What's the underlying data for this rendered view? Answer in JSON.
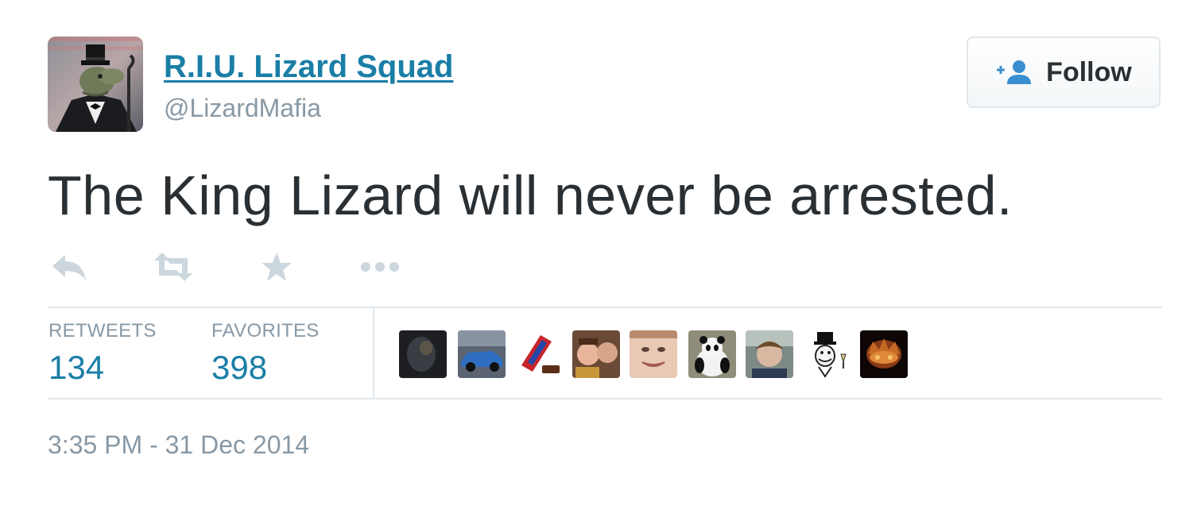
{
  "author": {
    "display_name": "R.I.U. Lizard Squad",
    "screen_name": "@LizardMafia",
    "avatar_icon": "lizard-in-top-hat-avatar"
  },
  "follow_button": {
    "label": "Follow",
    "icon": "add-user-icon"
  },
  "tweet": {
    "text": "The King Lizard will never be arrested."
  },
  "actions": [
    {
      "name": "reply",
      "icon": "reply-icon"
    },
    {
      "name": "retweet",
      "icon": "retweet-icon"
    },
    {
      "name": "favorite",
      "icon": "star-icon"
    },
    {
      "name": "more",
      "icon": "more-dots-icon"
    }
  ],
  "stats": {
    "retweets": {
      "label": "RETWEETS",
      "value": "134"
    },
    "favorites": {
      "label": "FAVORITES",
      "value": "398"
    }
  },
  "favoriter_avatars": [
    "dark-scene-avatar",
    "blue-car-avatar",
    "candy-bar-avatar",
    "two-kids-avatar",
    "smiling-face-avatar",
    "panda-avatar",
    "young-man-avatar",
    "top-hat-meme-avatar",
    "crown-avatar"
  ],
  "timestamp": "3:35 PM - 31 Dec 2014",
  "colors": {
    "link_blue": "#1a7ea6",
    "text_dark": "#292f33",
    "text_gray": "#8899a6",
    "icon_gray": "#ccd6dd",
    "divider": "#e1e8ed",
    "follow_icon_blue": "#3a8fd0"
  }
}
